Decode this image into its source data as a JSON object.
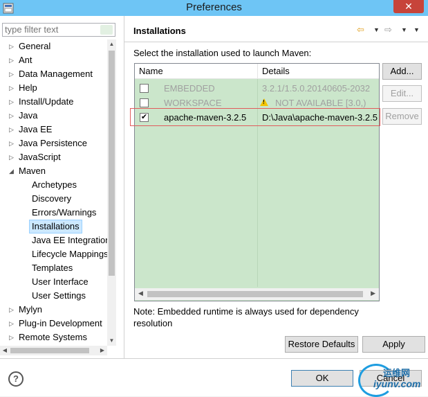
{
  "window": {
    "title": "Preferences",
    "close": "✕"
  },
  "filter": {
    "placeholder": "type filter text"
  },
  "tree": {
    "items": [
      {
        "label": "General",
        "level": 0
      },
      {
        "label": "Ant",
        "level": 0
      },
      {
        "label": "Data Management",
        "level": 0
      },
      {
        "label": "Help",
        "level": 0
      },
      {
        "label": "Install/Update",
        "level": 0
      },
      {
        "label": "Java",
        "level": 0
      },
      {
        "label": "Java EE",
        "level": 0
      },
      {
        "label": "Java Persistence",
        "level": 0
      },
      {
        "label": "JavaScript",
        "level": 0
      },
      {
        "label": "Maven",
        "level": 0,
        "expanded": true
      },
      {
        "label": "Archetypes",
        "level": 1
      },
      {
        "label": "Discovery",
        "level": 1
      },
      {
        "label": "Errors/Warnings",
        "level": 1
      },
      {
        "label": "Installations",
        "level": 1,
        "selected": true
      },
      {
        "label": "Java EE Integration",
        "level": 1
      },
      {
        "label": "Lifecycle Mappings",
        "level": 1
      },
      {
        "label": "Templates",
        "level": 1
      },
      {
        "label": "User Interface",
        "level": 1
      },
      {
        "label": "User Settings",
        "level": 1
      },
      {
        "label": "Mylyn",
        "level": 0
      },
      {
        "label": "Plug-in Development",
        "level": 0
      },
      {
        "label": "Remote Systems",
        "level": 0
      }
    ]
  },
  "page": {
    "title": "Installations",
    "instruction": "Select the installation used to launch Maven:",
    "columns": {
      "name": "Name",
      "details": "Details"
    },
    "rows": [
      {
        "name": "EMBEDDED",
        "details": "3.2.1/1.5.0.20140605-2032",
        "checked": false,
        "disabled": true
      },
      {
        "name": "WORKSPACE",
        "details": "NOT AVAILABLE [3.0,)",
        "checked": false,
        "disabled": true,
        "warning": true
      },
      {
        "name": "apache-maven-3.2.5",
        "details": "D:\\Java\\apache-maven-3.2.5",
        "checked": true,
        "disabled": false
      }
    ],
    "buttons": {
      "add": "Add...",
      "edit": "Edit...",
      "remove": "Remove"
    },
    "note": "Note: Embedded runtime is always used for dependency resolution",
    "restore_defaults": "Restore Defaults",
    "apply": "Apply"
  },
  "footer": {
    "ok": "OK",
    "cancel": "Cancel",
    "help": "?"
  },
  "watermark": {
    "cn": "运维网",
    "en": "iyunv.com"
  },
  "colors": {
    "titlebar": "#6ec5f5",
    "table_bg": "#cbe6cb",
    "selection": "#cce8ff",
    "highlight": "#e15b5b"
  }
}
